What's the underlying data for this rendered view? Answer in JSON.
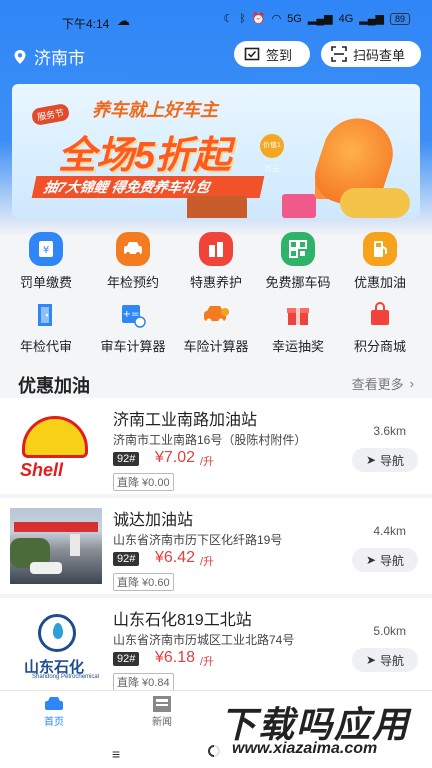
{
  "status_bar": {
    "time": "下午4:14",
    "battery": "89",
    "signal1": "5G",
    "signal2": "4G"
  },
  "header": {
    "city": "济南市",
    "sign_label": "签到",
    "scan_label": "扫码查单"
  },
  "banner": {
    "tag": "服务节",
    "line1": "养车就上好车主",
    "line2": "全场5折起",
    "strip": "抽7大锦鲤 得免费养车礼包",
    "badge": "价值1万元"
  },
  "services_row1": [
    {
      "label": "罚单缴费",
      "icon": "ticket-icon",
      "color": "#2f86f6"
    },
    {
      "label": "年检预约",
      "icon": "car-inspection-icon",
      "color": "#f47b20"
    },
    {
      "label": "特惠养护",
      "icon": "maintenance-icon",
      "color": "#f0433a"
    },
    {
      "label": "免费挪车码",
      "icon": "qr-code-icon",
      "color": "#2fb36a"
    },
    {
      "label": "优惠加油",
      "icon": "fuel-pump-icon",
      "color": "#f7a21b"
    }
  ],
  "services_row2": [
    {
      "label": "年检代审",
      "icon": "door-icon",
      "color": "#2f86f6"
    },
    {
      "label": "审车计算器",
      "icon": "calculator-icon",
      "color": "#2f86f6"
    },
    {
      "label": "车险计算器",
      "icon": "insurance-car-icon",
      "color": "#f47b20"
    },
    {
      "label": "幸运抽奖",
      "icon": "gift-icon",
      "color": "#f0433a"
    },
    {
      "label": "积分商城",
      "icon": "shopping-bag-icon",
      "color": "#f0433a"
    }
  ],
  "section": {
    "title": "优惠加油",
    "more": "查看更多"
  },
  "stations": [
    {
      "name": "济南工业南路加油站",
      "address": "济南市工业南路16号（股陈村附件）",
      "grade": "92#",
      "price": "¥7.02",
      "unit": "/升",
      "drop": "直降 ¥0.00",
      "distance": "3.6km",
      "nav": "导航",
      "logo_text": "Shell"
    },
    {
      "name": "诚达加油站",
      "address": "山东省济南市历下区化纤路19号",
      "grade": "92#",
      "price": "¥6.42",
      "unit": "/升",
      "drop": "直降 ¥0.60",
      "distance": "4.4km",
      "nav": "导航"
    },
    {
      "name": "山东石化819工北站",
      "address": "山东省济南市历城区工业北路74号",
      "grade": "92#",
      "price": "¥6.18",
      "unit": "/升",
      "drop": "直降 ¥0.84",
      "distance": "5.0km",
      "nav": "导航",
      "logo_text": "山东石化",
      "logo_sub": "Shandong Petrochemical"
    }
  ],
  "bottom_nav": {
    "home": "首页",
    "news": "新闻"
  },
  "watermark": {
    "title": "下载吗应用",
    "url": "www.xiazaima.com"
  }
}
